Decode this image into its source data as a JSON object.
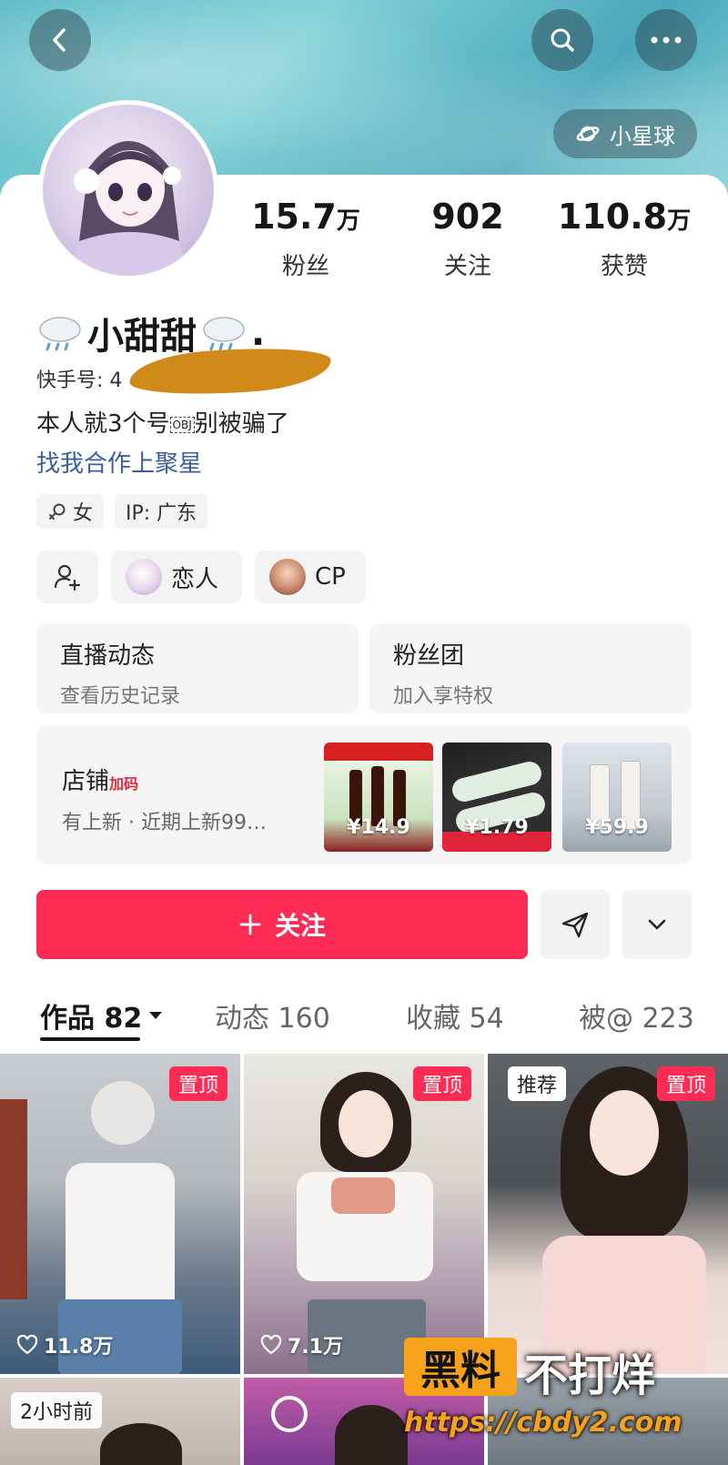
{
  "header": {
    "planet_label": "小星球"
  },
  "profile": {
    "nickname": "小甜甜",
    "nickname_suffix": ".",
    "uid_label": "快手号:",
    "uid_partial": "4",
    "bio_text": "本人就3个号",
    "bio_obj": "OBJ",
    "bio_text2": "别被骗了",
    "link": "找我合作上聚星"
  },
  "stats": [
    {
      "num": "15.7",
      "unit": "万",
      "label": "粉丝"
    },
    {
      "num": "902",
      "unit": "",
      "label": "关注"
    },
    {
      "num": "110.8",
      "unit": "万",
      "label": "获赞"
    }
  ],
  "tags": {
    "gender": "女",
    "ip": "IP: 广东"
  },
  "relations": {
    "lover": "恋人",
    "cp": "CP"
  },
  "cards": {
    "live": {
      "title": "直播动态",
      "sub": "查看历史记录"
    },
    "fans": {
      "title": "粉丝团",
      "sub": "加入享特权"
    }
  },
  "shop": {
    "title": "店铺",
    "title_tag": "加码",
    "sub": "有上新 · 近期上新99…",
    "products": [
      {
        "price": "¥14.9"
      },
      {
        "price": "¥1.79"
      },
      {
        "price": "¥59.9"
      }
    ]
  },
  "actions": {
    "follow": "关注"
  },
  "tabs": [
    {
      "label": "作品 82"
    },
    {
      "label": "动态 160"
    },
    {
      "label": "收藏 54"
    },
    {
      "label": "被@ 223"
    }
  ],
  "videos": [
    {
      "badge": "置顶",
      "likes": "11.8万"
    },
    {
      "badge": "置顶",
      "likes": "7.1万"
    },
    {
      "badge": "置顶",
      "badge2": "推荐",
      "likes": ""
    }
  ],
  "row2": {
    "time_badge": "2小时前"
  },
  "watermark": {
    "box": "黑料",
    "side": "不打烊",
    "url": "https://cbdy2.com"
  },
  "colors": {
    "accent": "#fe2c55",
    "link": "#3a5fa0",
    "watermark": "#f7a21b"
  }
}
